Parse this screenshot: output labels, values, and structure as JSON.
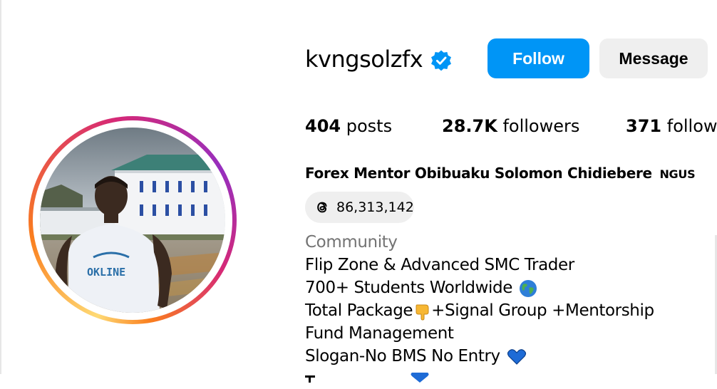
{
  "profile": {
    "username": "kvngsolzfx",
    "verified": true,
    "full_name": "Forex Mentor Obibuaku Solomon Chidiebere",
    "pronouns": "NGUS",
    "category": "Community"
  },
  "actions": {
    "follow_label": "Follow",
    "message_label": "Message"
  },
  "stats": {
    "posts_count": "404",
    "posts_label": "posts",
    "followers_count": "28.7K",
    "followers_label": "followers",
    "following_count": "371",
    "following_label": "followi"
  },
  "threads": {
    "icon": "threads-icon",
    "count": "86,313,142"
  },
  "bio": {
    "lines": [
      {
        "text": "Flip Zone & Advanced SMC Trader",
        "emoji": ""
      },
      {
        "text": "700+ Students Worldwide",
        "emoji": "globe-icon"
      },
      {
        "text": "Total Package",
        "emoji": "pointing-down-icon",
        "after": "+Signal Group +Mentorship"
      },
      {
        "text": "Fund Management",
        "emoji": ""
      },
      {
        "text": "Slogan-No BMS No Entry",
        "emoji": "blue-heart-icon"
      }
    ]
  },
  "colors": {
    "follow_button": "#0095f6",
    "message_button": "#efefef",
    "verified_badge": "#0095f6",
    "category_text": "#737373"
  }
}
